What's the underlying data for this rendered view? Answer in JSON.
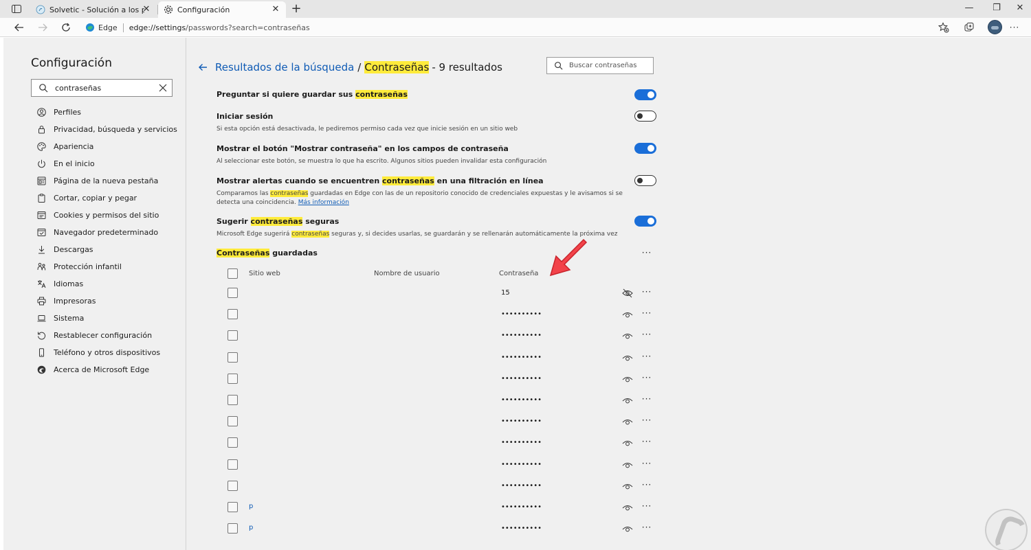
{
  "browser": {
    "tabs": [
      {
        "title": "Solvetic - Solución a los problem",
        "active": false
      },
      {
        "title": "Configuración",
        "active": true
      }
    ],
    "address": {
      "browser_name": "Edge",
      "url_host": "edge://settings",
      "url_path": "/passwords?search=contraseñas"
    }
  },
  "sidebar": {
    "title": "Configuración",
    "search_value": "contraseñas",
    "items": [
      {
        "label": "Perfiles",
        "icon": "profile-icon"
      },
      {
        "label": "Privacidad, búsqueda y servicios",
        "icon": "lock-icon"
      },
      {
        "label": "Apariencia",
        "icon": "palette-icon"
      },
      {
        "label": "En el inicio",
        "icon": "power-icon"
      },
      {
        "label": "Página de la nueva pestaña",
        "icon": "new-tab-icon"
      },
      {
        "label": "Cortar, copiar y pegar",
        "icon": "clipboard-icon"
      },
      {
        "label": "Cookies y permisos del sitio",
        "icon": "site-permissions-icon"
      },
      {
        "label": "Navegador predeterminado",
        "icon": "default-browser-icon"
      },
      {
        "label": "Descargas",
        "icon": "download-icon"
      },
      {
        "label": "Protección infantil",
        "icon": "family-icon"
      },
      {
        "label": "Idiomas",
        "icon": "language-icon"
      },
      {
        "label": "Impresoras",
        "icon": "printer-icon"
      },
      {
        "label": "Sistema",
        "icon": "laptop-icon"
      },
      {
        "label": "Restablecer configuración",
        "icon": "reset-icon"
      },
      {
        "label": "Teléfono y otros dispositivos",
        "icon": "phone-icon"
      },
      {
        "label": "Acerca de Microsoft Edge",
        "icon": "edge-icon"
      }
    ]
  },
  "main": {
    "breadcrumb": "Resultados de la búsqueda",
    "separator": "/",
    "section": "Contraseñas",
    "result_count": "- 9 resultados",
    "search_placeholder": "Buscar contraseñas",
    "settings": [
      {
        "title_pre": "Preguntar si quiere guardar sus ",
        "title_hl": "contraseñas",
        "title_post": "",
        "enabled": true
      },
      {
        "title_pre": "Iniciar sesión",
        "title_hl": "",
        "title_post": "",
        "desc": "Si esta opción está desactivada, le pediremos permiso cada vez que inicie sesión en un sitio web",
        "enabled": false
      },
      {
        "title_pre": "Mostrar el botón \"Mostrar contraseña\" en los campos de contraseña",
        "title_hl": "",
        "title_post": "",
        "desc": "Al seleccionar este botón, se muestra lo que ha escrito. Algunos sitios pueden invalidar esta configuración",
        "enabled": true
      },
      {
        "title_pre": "Mostrar alertas cuando se encuentren ",
        "title_hl": "contraseñas",
        "title_post": " en una filtración en línea",
        "desc_pre": "Comparamos las ",
        "desc_hl": "contraseñas",
        "desc_post": " guardadas en Edge con las de un repositorio conocido de credenciales expuestas y le avisamos si se detecta una coincidencia. ",
        "desc_link": "Más información",
        "enabled": false
      },
      {
        "title_pre": "Sugerir ",
        "title_hl": "contraseñas",
        "title_post": " seguras",
        "desc_pre": "Microsoft Edge sugerirá ",
        "desc_hl": "contraseñas",
        "desc_post": " seguras y, si decides usarlas, se guardarán y se rellenarán automáticamente la próxima vez",
        "enabled": true
      }
    ],
    "saved": {
      "title_hl": "Contraseñas",
      "title_post": " guardadas",
      "more": "···",
      "columns": [
        "Sitio web",
        "Nombre de usuario",
        "Contraseña"
      ],
      "rows": [
        {
          "site": "",
          "password": "15",
          "revealed": true
        },
        {
          "site": "",
          "password": "••••••••••",
          "revealed": false
        },
        {
          "site": "",
          "password": "••••••••••",
          "revealed": false
        },
        {
          "site": "",
          "password": "••••••••••",
          "revealed": false
        },
        {
          "site": "",
          "password": "••••••••••",
          "revealed": false
        },
        {
          "site": "",
          "password": "••••••••••",
          "revealed": false
        },
        {
          "site": "",
          "password": "••••••••••",
          "revealed": false
        },
        {
          "site": "",
          "password": "••••••••••",
          "revealed": false
        },
        {
          "site": "",
          "password": "••••••••••",
          "revealed": false
        },
        {
          "site": "",
          "password": "••••••••••",
          "revealed": false
        },
        {
          "site": "p",
          "password": "••••••••••",
          "revealed": false
        },
        {
          "site": "p",
          "password": "••••••••••",
          "revealed": false
        }
      ]
    }
  },
  "colors": {
    "accent": "#1a6ed8",
    "link": "#0f5bb5",
    "highlight": "#ffeb3b",
    "annotation_arrow": "#f2434a"
  }
}
